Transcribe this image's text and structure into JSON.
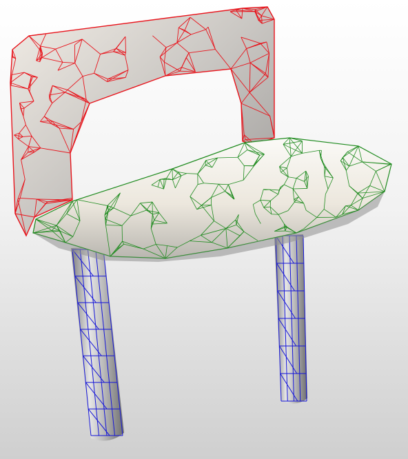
{
  "scene": {
    "object": "chair-mesh",
    "parts": [
      {
        "id": "backrest",
        "wire_color": "#e8121a"
      },
      {
        "id": "seat",
        "wire_color": "#1d8a1d"
      },
      {
        "id": "leg-front-left",
        "wire_color": "#1515d8"
      },
      {
        "id": "leg-back-right",
        "wire_color": "#1515d8"
      }
    ],
    "shading": {
      "base": "#eeeae4",
      "shadow": "#8e8e8e",
      "highlight": "#fbfaf7"
    },
    "background": {
      "top": "#ffffff",
      "bottom": "#cfcfcf"
    }
  }
}
